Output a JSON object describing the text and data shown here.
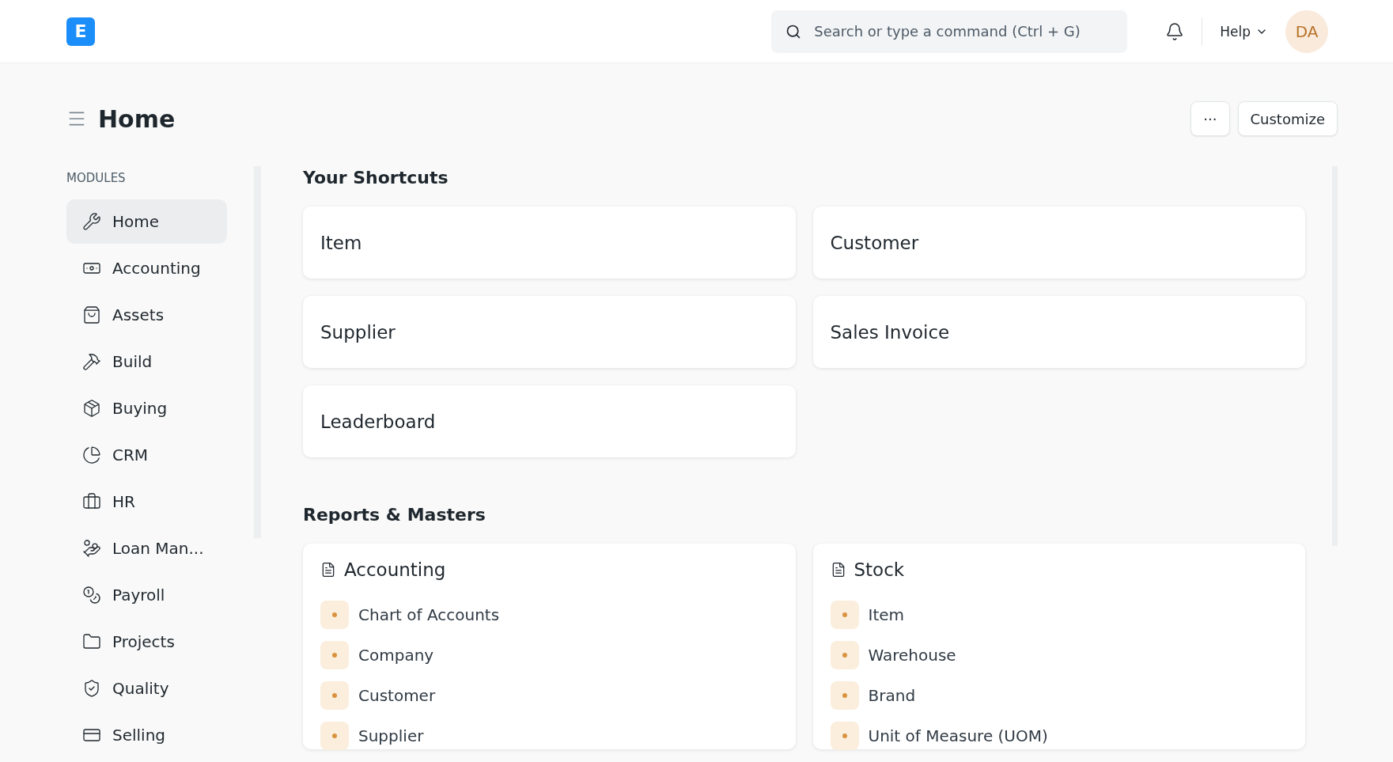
{
  "navbar": {
    "logo": "E",
    "search": {
      "placeholder": "Search or type a command (Ctrl + G)"
    },
    "help": "Help",
    "avatar": "DA"
  },
  "page_header": {
    "title": "Home",
    "buttons": [
      "···",
      "Customize"
    ]
  },
  "sidebar": {
    "heading": "MODULES",
    "items": [
      {
        "label": "Home",
        "selected": true
      },
      {
        "label": "Accounting",
        "selected": false
      },
      {
        "label": "Assets",
        "selected": false
      },
      {
        "label": "Build",
        "selected": false
      },
      {
        "label": "Buying",
        "selected": false
      },
      {
        "label": "CRM",
        "selected": false
      },
      {
        "label": "HR",
        "selected": false
      },
      {
        "label": "Loan Man...",
        "selected": false
      },
      {
        "label": "Payroll",
        "selected": false
      },
      {
        "label": "Projects",
        "selected": false
      },
      {
        "label": "Quality",
        "selected": false
      },
      {
        "label": "Selling",
        "selected": false
      }
    ]
  },
  "shortcuts": {
    "title": "Your Shortcuts",
    "items": [
      "Item",
      "Customer",
      "Supplier",
      "Sales Invoice",
      "Leaderboard"
    ]
  },
  "reports": {
    "title": "Reports & Masters",
    "cards": [
      {
        "title": "Accounting",
        "links": [
          "Chart of Accounts",
          "Company",
          "Customer",
          "Supplier"
        ]
      },
      {
        "title": "Stock",
        "links": [
          "Item",
          "Warehouse",
          "Brand",
          "Unit of Measure (UOM)"
        ]
      }
    ]
  }
}
